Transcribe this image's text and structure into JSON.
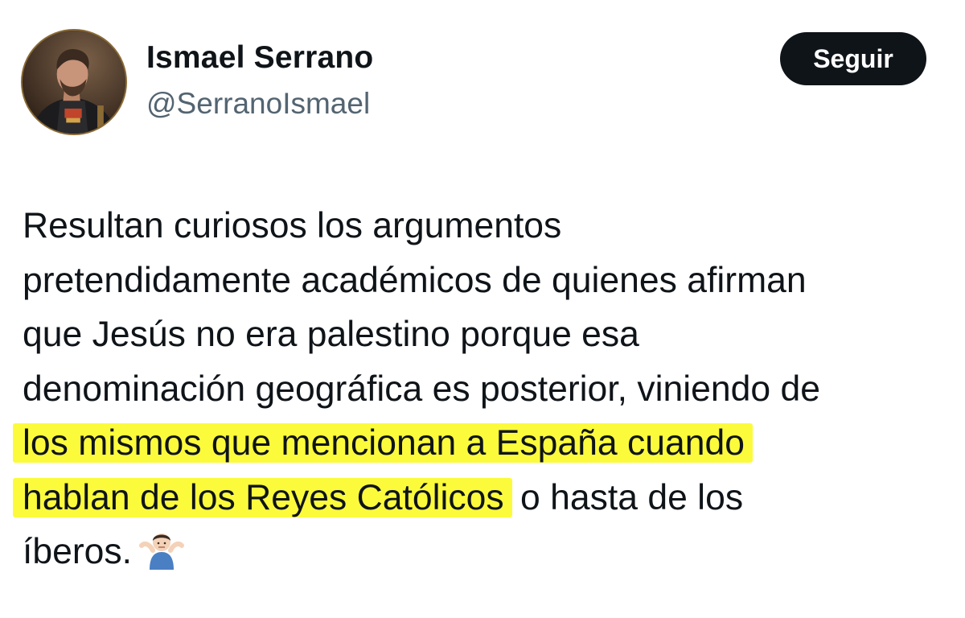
{
  "user": {
    "name": "Ismael Serrano",
    "handle": "@SerranoIsmael",
    "avatar_icon": "profile-photo"
  },
  "follow_button": {
    "label": "Seguir"
  },
  "tweet": {
    "lines": [
      {
        "pre": "Resultan curiosos los argumentos",
        "highlight": "",
        "post": ""
      },
      {
        "pre": "pretendidamente académicos de quienes afirman",
        "highlight": "",
        "post": ""
      },
      {
        "pre": "que Jesús no era palestino porque esa",
        "highlight": "",
        "post": ""
      },
      {
        "pre": "denominación geográfica es posterior, viniendo de",
        "highlight": "",
        "post": ""
      },
      {
        "pre": "",
        "highlight": "los mismos que mencionan a España cuando",
        "post": ""
      },
      {
        "pre": "",
        "highlight": "hablan de los Reyes Católicos",
        "post": " o hasta de los"
      },
      {
        "pre": "íberos.",
        "highlight": "",
        "post": ""
      }
    ],
    "emoji": "person-shrugging-emoji",
    "highlight_color": "#fbfb3c"
  },
  "colors": {
    "text": "#0f1419",
    "secondary": "#536471",
    "button_bg": "#0f1419"
  }
}
